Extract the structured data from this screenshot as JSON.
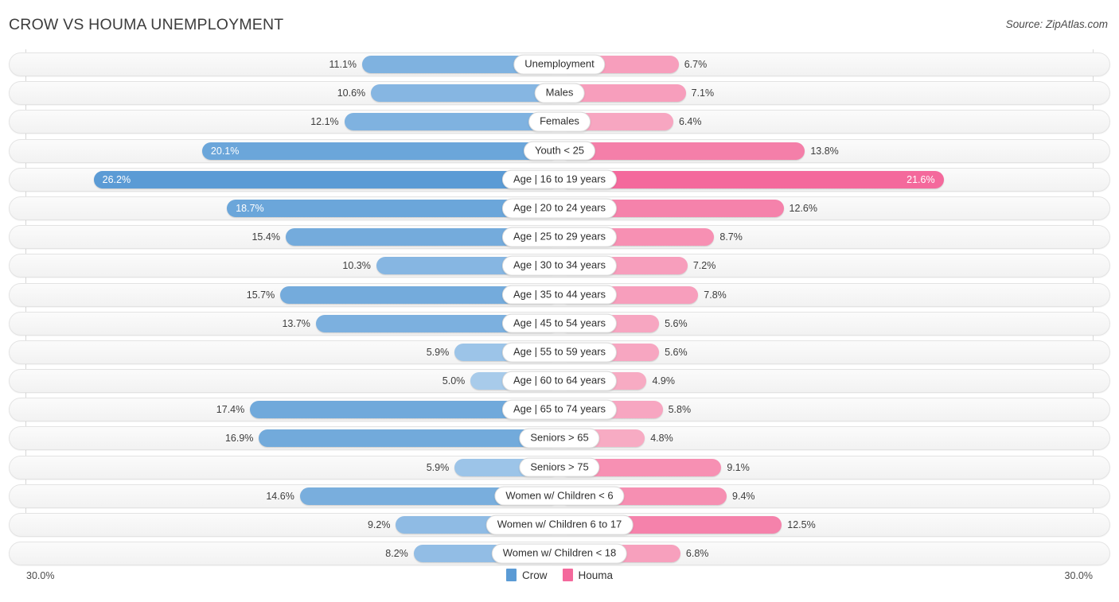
{
  "header": {
    "title": "CROW VS HOUMA UNEMPLOYMENT",
    "source": "Source: ZipAtlas.com"
  },
  "legend": {
    "left": {
      "label": "Crow",
      "color": "#5b9bd5"
    },
    "right": {
      "label": "Houma",
      "color": "#f4699c"
    }
  },
  "axis": {
    "left_max_label": "30.0%",
    "right_max_label": "30.0%",
    "max_value": 30.0
  },
  "chart_data": {
    "type": "bar",
    "orientation": "diverging-horizontal",
    "title": "CROW VS HOUMA UNEMPLOYMENT",
    "xlabel": "",
    "ylabel": "",
    "xlim": [
      0,
      30
    ],
    "grid": false,
    "legend_position": "bottom-center",
    "categories": [
      "Unemployment",
      "Males",
      "Females",
      "Youth < 25",
      "Age | 16 to 19 years",
      "Age | 20 to 24 years",
      "Age | 25 to 29 years",
      "Age | 30 to 34 years",
      "Age | 35 to 44 years",
      "Age | 45 to 54 years",
      "Age | 55 to 59 years",
      "Age | 60 to 64 years",
      "Age | 65 to 74 years",
      "Seniors > 65",
      "Seniors > 75",
      "Women w/ Children < 6",
      "Women w/ Children 6 to 17",
      "Women w/ Children < 18"
    ],
    "series": [
      {
        "name": "Crow",
        "color": "#5b9bd5",
        "values": [
          11.1,
          10.6,
          12.1,
          20.1,
          26.2,
          18.7,
          15.4,
          10.3,
          15.7,
          13.7,
          5.9,
          5.0,
          17.4,
          16.9,
          5.9,
          14.6,
          9.2,
          8.2
        ]
      },
      {
        "name": "Houma",
        "color": "#f4699c",
        "values": [
          6.7,
          7.1,
          6.4,
          13.8,
          21.6,
          12.6,
          8.7,
          7.2,
          7.8,
          5.6,
          5.6,
          4.9,
          5.8,
          4.8,
          9.1,
          9.4,
          12.5,
          6.8
        ]
      }
    ]
  },
  "rows": [
    {
      "label": "Unemployment",
      "left": {
        "text": "11.1%",
        "value": 11.1,
        "color": "#7fb2e0",
        "inside": false
      },
      "right": {
        "text": "6.7%",
        "value": 6.7,
        "color": "#f79ebc",
        "inside": false
      }
    },
    {
      "label": "Males",
      "left": {
        "text": "10.6%",
        "value": 10.6,
        "color": "#86b6e2",
        "inside": false
      },
      "right": {
        "text": "7.1%",
        "value": 7.1,
        "color": "#f79ebc",
        "inside": false
      }
    },
    {
      "label": "Females",
      "left": {
        "text": "12.1%",
        "value": 12.1,
        "color": "#7fb2e0",
        "inside": false
      },
      "right": {
        "text": "6.4%",
        "value": 6.4,
        "color": "#f7a6c1",
        "inside": false
      }
    },
    {
      "label": "Youth < 25",
      "left": {
        "text": "20.1%",
        "value": 20.1,
        "color": "#6ba6da",
        "inside": true
      },
      "right": {
        "text": "13.8%",
        "value": 13.8,
        "color": "#f47fa9",
        "inside": false
      }
    },
    {
      "label": "Age | 16 to 19 years",
      "left": {
        "text": "26.2%",
        "value": 26.2,
        "color": "#5b9bd5",
        "inside": true
      },
      "right": {
        "text": "21.6%",
        "value": 21.6,
        "color": "#f4699c",
        "inside": true
      }
    },
    {
      "label": "Age | 20 to 24 years",
      "left": {
        "text": "18.7%",
        "value": 18.7,
        "color": "#6ba6da",
        "inside": true
      },
      "right": {
        "text": "12.6%",
        "value": 12.6,
        "color": "#f582ab",
        "inside": false
      }
    },
    {
      "label": "Age | 25 to 29 years",
      "left": {
        "text": "15.4%",
        "value": 15.4,
        "color": "#74abdc",
        "inside": false
      },
      "right": {
        "text": "8.7%",
        "value": 8.7,
        "color": "#f790b3",
        "inside": false
      }
    },
    {
      "label": "Age | 30 to 34 years",
      "left": {
        "text": "10.3%",
        "value": 10.3,
        "color": "#86b6e2",
        "inside": false
      },
      "right": {
        "text": "7.2%",
        "value": 7.2,
        "color": "#f79ebc",
        "inside": false
      }
    },
    {
      "label": "Age | 35 to 44 years",
      "left": {
        "text": "15.7%",
        "value": 15.7,
        "color": "#74abdc",
        "inside": false
      },
      "right": {
        "text": "7.8%",
        "value": 7.8,
        "color": "#f79ebc",
        "inside": false
      }
    },
    {
      "label": "Age | 45 to 54 years",
      "left": {
        "text": "13.7%",
        "value": 13.7,
        "color": "#7cb0df",
        "inside": false
      },
      "right": {
        "text": "5.6%",
        "value": 5.6,
        "color": "#f7a6c1",
        "inside": false
      }
    },
    {
      "label": "Age | 55 to 59 years",
      "left": {
        "text": "5.9%",
        "value": 5.9,
        "color": "#9cc4e8",
        "inside": false
      },
      "right": {
        "text": "5.6%",
        "value": 5.6,
        "color": "#f7a6c1",
        "inside": false
      }
    },
    {
      "label": "Age | 60 to 64 years",
      "left": {
        "text": "5.0%",
        "value": 5.0,
        "color": "#a8cbea",
        "inside": false
      },
      "right": {
        "text": "4.9%",
        "value": 4.9,
        "color": "#f7abc3",
        "inside": false
      }
    },
    {
      "label": "Age | 65 to 74 years",
      "left": {
        "text": "17.4%",
        "value": 17.4,
        "color": "#70a9db",
        "inside": false
      },
      "right": {
        "text": "5.8%",
        "value": 5.8,
        "color": "#f7a6c1",
        "inside": false
      }
    },
    {
      "label": "Seniors > 65",
      "left": {
        "text": "16.9%",
        "value": 16.9,
        "color": "#72aadb",
        "inside": false
      },
      "right": {
        "text": "4.8%",
        "value": 4.8,
        "color": "#f7abc3",
        "inside": false
      }
    },
    {
      "label": "Seniors > 75",
      "left": {
        "text": "5.9%",
        "value": 5.9,
        "color": "#9cc4e8",
        "inside": false
      },
      "right": {
        "text": "9.1%",
        "value": 9.1,
        "color": "#f790b3",
        "inside": false
      }
    },
    {
      "label": "Women w/ Children < 6",
      "left": {
        "text": "14.6%",
        "value": 14.6,
        "color": "#79aedd",
        "inside": false
      },
      "right": {
        "text": "9.4%",
        "value": 9.4,
        "color": "#f68fb2",
        "inside": false
      }
    },
    {
      "label": "Women w/ Children 6 to 17",
      "left": {
        "text": "9.2%",
        "value": 9.2,
        "color": "#8fbbe4",
        "inside": false
      },
      "right": {
        "text": "12.5%",
        "value": 12.5,
        "color": "#f582ab",
        "inside": false
      }
    },
    {
      "label": "Women w/ Children < 18",
      "left": {
        "text": "8.2%",
        "value": 8.2,
        "color": "#92bde5",
        "inside": false
      },
      "right": {
        "text": "6.8%",
        "value": 6.8,
        "color": "#f7a0bd",
        "inside": false
      }
    }
  ]
}
